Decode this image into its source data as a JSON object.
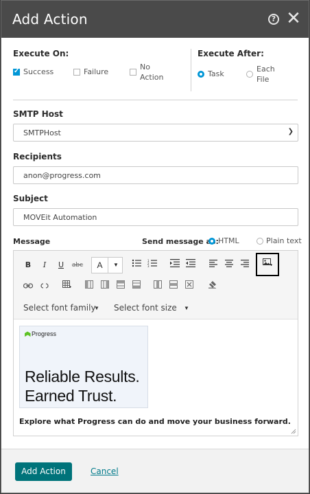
{
  "dialog": {
    "title": "Add Action"
  },
  "execute_on": {
    "label": "Execute On:",
    "options": [
      {
        "label": "Success",
        "checked": true
      },
      {
        "label": "Failure",
        "checked": false
      },
      {
        "label_line1": "No",
        "label_line2": "Action",
        "checked": false
      }
    ]
  },
  "execute_after": {
    "label": "Execute After:",
    "options": [
      {
        "label": "Task",
        "selected": true
      },
      {
        "label_line1": "Each",
        "label_line2": "File",
        "selected": false
      }
    ]
  },
  "smtp_host": {
    "label": "SMTP Host",
    "value": "SMTPHost"
  },
  "recipients": {
    "label": "Recipients",
    "value": "anon@progress.com"
  },
  "subject": {
    "label": "Subject",
    "value": "MOVEit Automation"
  },
  "message": {
    "label": "Message",
    "send_as_label": "Send message as:",
    "formats": [
      {
        "label": "HTML",
        "selected": true
      },
      {
        "label": "Plain text",
        "selected": false
      }
    ],
    "toolbar": {
      "font_color_label": "A",
      "font_family_placeholder": "Select font family",
      "font_size_placeholder": "Select font size"
    },
    "content": {
      "logo_text": "Progress",
      "headline_line1": "Reliable Results.",
      "headline_line2": "Earned Trust.",
      "body": "Explore what Progress can do and move your business forward."
    }
  },
  "footer": {
    "primary_label": "Add Action",
    "cancel_label": "Cancel"
  },
  "colors": {
    "titlebar": "#4a4a4a",
    "accent_blue": "#0096d6",
    "primary_button": "#00737a",
    "link": "#007a8a",
    "logo_green": "#5ec226"
  }
}
